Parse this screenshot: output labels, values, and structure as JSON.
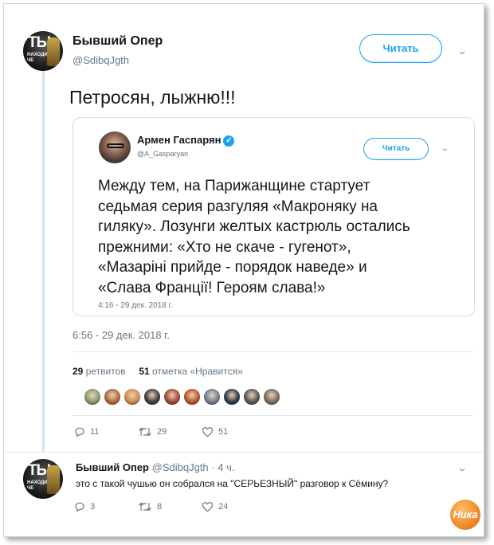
{
  "tweet": {
    "author_name": "Бывший Опер",
    "author_handle": "@SdibqJgth",
    "avatar_text_big": "ТЫ",
    "avatar_text_small": "НАХОДИ ЧЕ",
    "follow_label": "Читать",
    "text": "Петросян, лыжню!!!",
    "timestamp": "6:56 - 29 дек. 2018 г.",
    "retweets_count": "29",
    "retweets_label": "ретвитов",
    "likes_count": "51",
    "likes_label": "отметка «Нравится»",
    "actions": {
      "reply": "11",
      "retweet": "29",
      "like": "51"
    },
    "liker_colors": [
      "#8a9a6a",
      "#b0663c",
      "#d28a4a",
      "#3b3b3b",
      "#a0463a",
      "#b8542a",
      "#6f7f8f",
      "#2a3a4a",
      "#555555",
      "#7a6a5a"
    ]
  },
  "quote": {
    "author_name": "Армен Гаспарян",
    "author_handle": "@A_Gasparyan",
    "follow_label": "Читать",
    "lines": [
      "Между тем, на Парижанщине стартует",
      "седьмая серия разгуляя «Макроняку на",
      "гиляку». Лозунги желтых кастрюль остались",
      "прежними: «Хто не скаче - гугенот»,",
      "«Мазаріні прийде - порядок наведе» и",
      "«Слава Францiї! Героям слава!»"
    ],
    "time": "4:16 - 29 дек. 2018 г."
  },
  "reply": {
    "author_name": "Бывший Опер",
    "meta": "@SdibqJgth · 4 ч.",
    "text": "это с такой чушью он собрался на \"СЕРЬЕЗНЫЙ\"  разговор к Сёмину?",
    "actions": {
      "reply": "3",
      "retweet": "8",
      "like": "24"
    }
  },
  "watermark": "Ника",
  "colors": {
    "accent": "#1da1f2",
    "muted": "#657786",
    "thread": "#cfe3f7"
  }
}
